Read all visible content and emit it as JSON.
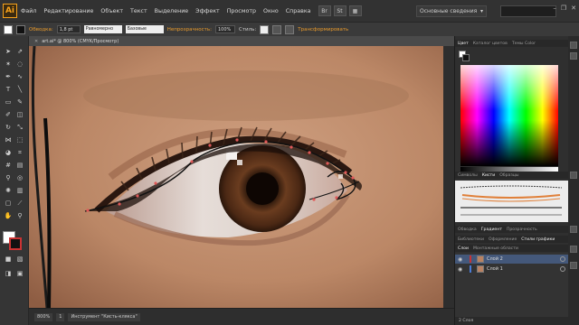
{
  "app": {
    "logo": "Ai"
  },
  "menu": [
    "Файл",
    "Редактирование",
    "Объект",
    "Текст",
    "Выделение",
    "Эффект",
    "Просмотр",
    "Окно",
    "Справка"
  ],
  "menubar_icons": [
    "Br",
    "St"
  ],
  "workspace": {
    "label": "Основные сведения",
    "arrow": "▾"
  },
  "window_controls": [
    "–",
    "❐",
    "✕"
  ],
  "control": {
    "stroke_label": "Обводка:",
    "stroke_weight": "1,8 pt",
    "profile1": "Равномерно",
    "profile2": "Базовые",
    "opacity_label": "Непрозрачность:",
    "opacity_value": "100%",
    "styles_label": "Стиль:",
    "transform_label": "Трансформировать"
  },
  "document": {
    "title": "art.ai* @ 800% (CMYK/Просмотр)",
    "close": "✕"
  },
  "statusbar": {
    "zoom": "800%",
    "page": "1",
    "tool": "Инструмент \"Кисть-клякса\""
  },
  "panels": {
    "color_tabs": [
      "Цвет",
      "Каталог цветов",
      "Темы Color"
    ],
    "brush_tabs": [
      "Символы",
      "Кисти",
      "Образцы"
    ],
    "mid_tabs": [
      "Обводка",
      "Градиент",
      "Прозрачность"
    ],
    "lib_tabs": [
      "Библиотеки",
      "Оформление",
      "Стили графики"
    ],
    "layer_tabs": [
      "Слои",
      "Монтажные области"
    ],
    "layers": [
      {
        "name": "Слой 2",
        "color": "#c83232",
        "selected": true
      },
      {
        "name": "Слой 1",
        "color": "#4a7bd6",
        "selected": false
      }
    ],
    "layers_count": "2 Слоя"
  },
  "colors": {
    "accent": "#e89a2c",
    "layer_selected": "#44587a",
    "skin": "#c08e6c",
    "iris": "#5a3219"
  }
}
